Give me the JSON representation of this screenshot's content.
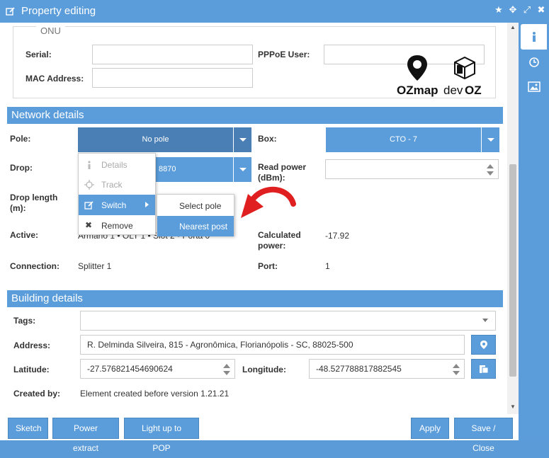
{
  "window": {
    "title": "Property editing"
  },
  "onu": {
    "legend": "ONU",
    "serial_label": "Serial:",
    "serial_value": "",
    "pppoe_label": "PPPoE User:",
    "pppoe_value": "",
    "mac_label": "MAC Address:",
    "mac_value": "",
    "logo_ozmap_text": "OZmap",
    "logo_devoz_dev": "dev",
    "logo_devoz_oz": "OZ"
  },
  "network": {
    "title": "Network details",
    "pole_label": "Pole:",
    "pole_value": "No pole",
    "box_label": "Box:",
    "box_value": "CTO - 7",
    "drop_label": "Drop:",
    "drop_value_partial": "8870",
    "read_power_label": "Read power (dBm):",
    "drop_length_label": "Drop length (m):",
    "active_label": "Active:",
    "active_value_partial": "Armário 1 • OLT 1 • Slot 2 • Porta 0",
    "calc_power_label": "Calculated power:",
    "calc_power_value": "-17.92",
    "connection_label": "Connection:",
    "connection_value": "Splitter 1",
    "port_label": "Port:",
    "port_value": "1"
  },
  "context_menu": {
    "items": [
      "Details",
      "Track",
      "Switch",
      "Remove"
    ],
    "submenu": [
      "Select pole",
      "Nearest post"
    ]
  },
  "building": {
    "title": "Building details",
    "tags_label": "Tags:",
    "address_label": "Address:",
    "address_value": "R. Delminda Silveira, 815 - Agronômica, Florianópolis - SC, 88025-500",
    "latitude_label": "Latitude:",
    "latitude_value": "-27.576821454690624",
    "longitude_label": "Longitude:",
    "longitude_value": "-48.527788817882545",
    "created_by_label": "Created by:",
    "created_by_value": "Element created before version 1.21.21"
  },
  "footer": {
    "sketch": "Sketch",
    "power_extract": "Power extract",
    "light_up": "Light up to POP",
    "apply": "Apply",
    "save_close": "Save / Close"
  },
  "colors": {
    "accent": "#5b9ddb",
    "accent_dark": "#4a7fb5",
    "arrow": "#e02020"
  }
}
